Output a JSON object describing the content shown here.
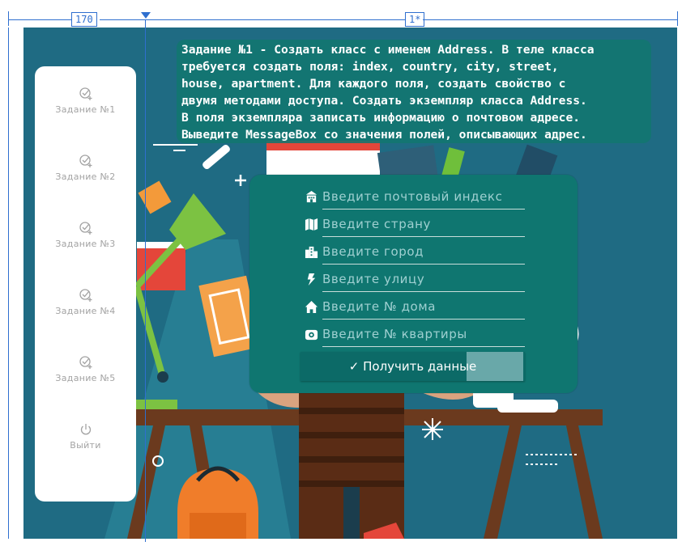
{
  "ruler": {
    "column1_width": "170",
    "column2_width": "1*",
    "line_color": "#2f6fcf"
  },
  "colors": {
    "background": "#1f6b83",
    "panel": "#0f7670",
    "sidebar": "#ffffff",
    "sidebar_text": "#a3a3a3",
    "placeholder": "#9fd0d1"
  },
  "sidebar": {
    "items": [
      {
        "label": "Задание №1",
        "icon": "task-check-icon"
      },
      {
        "label": "Задание №2",
        "icon": "task-check-icon"
      },
      {
        "label": "Задание №3",
        "icon": "task-check-icon"
      },
      {
        "label": "Задание №4",
        "icon": "task-check-icon"
      },
      {
        "label": "Задание №5",
        "icon": "task-check-icon"
      },
      {
        "label": "Выйти",
        "icon": "power-icon"
      }
    ]
  },
  "task": {
    "text": "Задание №1 - Создать класс с именем Address. В теле класса\nтребуется создать поля: index, country, city, street,\nhouse, apartment. Для каждого поля, создать свойство с\nдвумя методами доступа. Создать экземпляр класса Address.\nВ поля экземпляра записать информацию о почтовом адресе.\nВыведите MessageBox со значения полей, описывающих адрес."
  },
  "form": {
    "fields": [
      {
        "icon": "post-office-icon",
        "placeholder": "Введите почтовый индекс",
        "value": ""
      },
      {
        "icon": "map-icon",
        "placeholder": "Введите страну",
        "value": ""
      },
      {
        "icon": "city-icon",
        "placeholder": "Введите город",
        "value": ""
      },
      {
        "icon": "street-bolt-icon",
        "placeholder": "Введите улицу",
        "value": ""
      },
      {
        "icon": "home-icon",
        "placeholder": "Введите № дома",
        "value": ""
      },
      {
        "icon": "apartment-icon",
        "placeholder": "Введите № квартиры",
        "value": ""
      }
    ],
    "submit_label": "Получить данные",
    "submit_icon": "checkmark-icon"
  }
}
